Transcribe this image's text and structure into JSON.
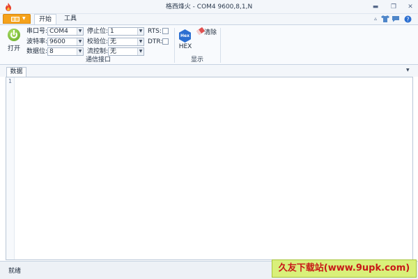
{
  "window": {
    "title": "格西烽火 - COM4  9600,8,1,N",
    "controls": [
      "minimize-icon",
      "restore-icon",
      "close-icon"
    ]
  },
  "ribbon_tabs": [
    "开始",
    "工具"
  ],
  "quick_access": [
    "up-arrow-icon",
    "tshirt-icon",
    "chat-icon",
    "help-icon"
  ],
  "ribbon": {
    "open_label": "打开",
    "comm": {
      "group_label": "通信接口",
      "fields": [
        {
          "label": "串口号:",
          "value": "COM4"
        },
        {
          "label": "波特率:",
          "value": "9600"
        },
        {
          "label": "数据位:",
          "value": "8"
        }
      ],
      "fields2": [
        {
          "label": "停止位:",
          "value": "1"
        },
        {
          "label": "校验位:",
          "value": "无"
        },
        {
          "label": "流控制:",
          "value": "无"
        }
      ],
      "checks": [
        {
          "label": "RTS:",
          "checked": false
        },
        {
          "label": "DTR:",
          "checked": false
        }
      ]
    },
    "display": {
      "group_label": "显示",
      "hex_icon_text": "Hex",
      "hex_label": "HEX",
      "clear_label": "清除"
    }
  },
  "document": {
    "tab_label": "数据",
    "line_numbers": [
      "1"
    ]
  },
  "status": {
    "text": "就绪"
  },
  "watermark": "久友下载站(www.9upk.com)",
  "colors": {
    "file_button": "#f5a21b",
    "accent_blue": "#2c6fd1",
    "watermark_bg": "#d9f07a",
    "watermark_text": "#c81818"
  }
}
